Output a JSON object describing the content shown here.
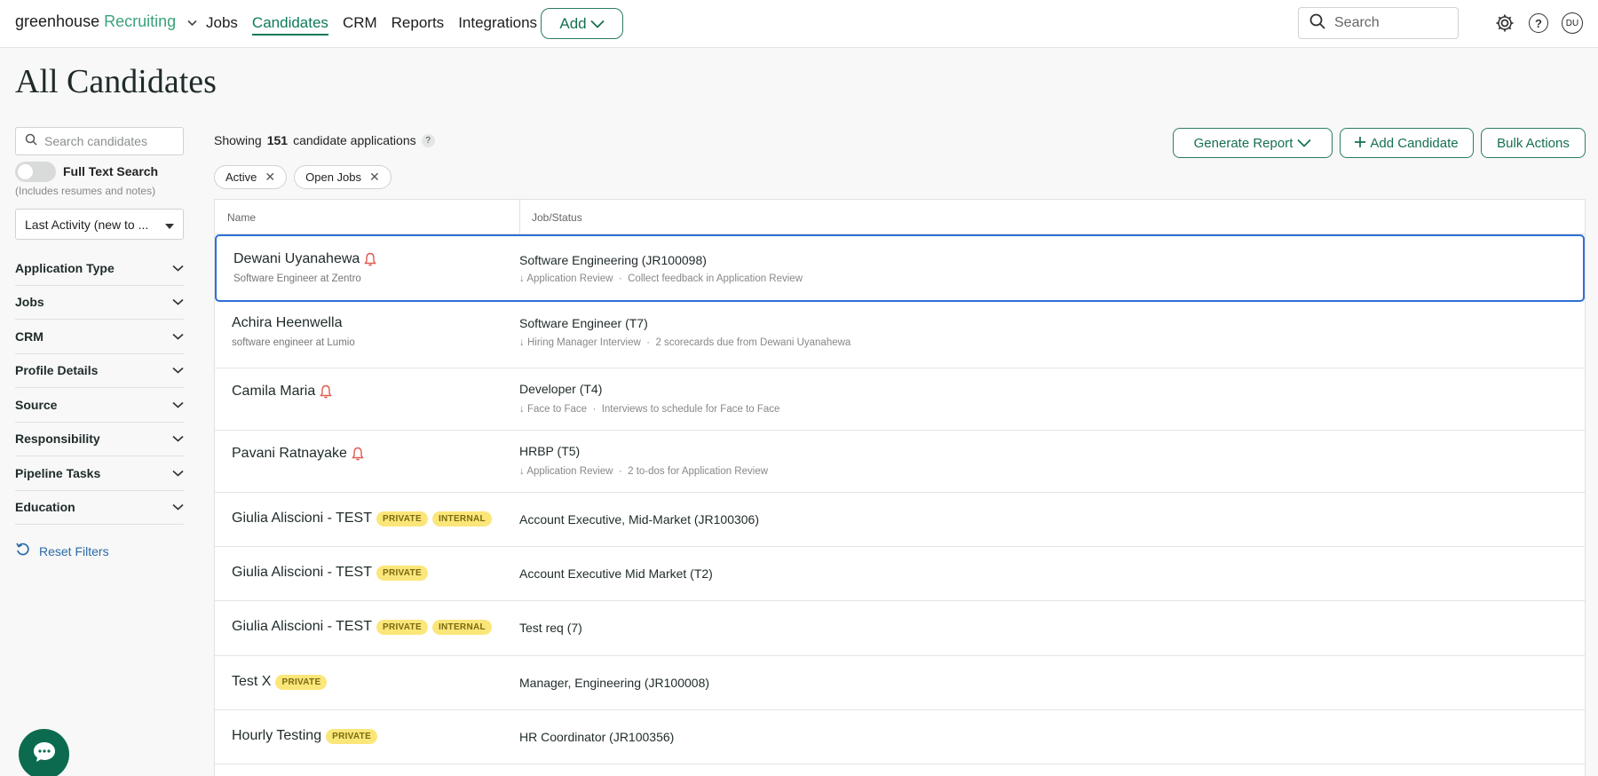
{
  "topnav": {
    "brand_primary": "greenhouse",
    "brand_secondary": "Recruiting",
    "links": [
      "Jobs",
      "Candidates",
      "CRM",
      "Reports",
      "Integrations"
    ],
    "active_link": "Candidates",
    "add_label": "Add",
    "search_placeholder": "Search",
    "avatar_initials": "DU"
  },
  "page": {
    "title": "All Candidates"
  },
  "sidebar": {
    "search_placeholder": "Search candidates",
    "full_text_label": "Full Text Search",
    "full_text_note": "(Includes resumes and notes)",
    "full_text_enabled": false,
    "sort_value": "Last Activity (new to ...",
    "filters": [
      "Application Type",
      "Jobs",
      "CRM",
      "Profile Details",
      "Source",
      "Responsibility",
      "Pipeline Tasks",
      "Education"
    ],
    "reset_label": "Reset Filters"
  },
  "main": {
    "showing_prefix": "Showing",
    "showing_count": "151",
    "showing_suffix": "candidate applications",
    "help_glyph": "?",
    "chips": [
      "Active",
      "Open Jobs"
    ],
    "generate_report_label": "Generate Report",
    "add_candidate_label": "Add Candidate",
    "bulk_actions_label": "Bulk Actions",
    "columns": {
      "name": "Name",
      "job_status": "Job/Status"
    }
  },
  "rows": [
    {
      "name": "Dewani Uyanahewa",
      "alert": true,
      "subtitle": "Software Engineer at Zentro",
      "badges": [],
      "job": "Software Engineering (JR100098)",
      "stage": "Application Review",
      "status": "Collect feedback in Application Review",
      "selected": true
    },
    {
      "name": "Achira Heenwella",
      "alert": false,
      "subtitle": "software engineer at Lumio",
      "badges": [],
      "job": "Software Engineer (T7)",
      "stage": "Hiring Manager Interview",
      "status": "2 scorecards due from Dewani Uyanahewa",
      "selected": false
    },
    {
      "name": "Camila Maria",
      "alert": true,
      "subtitle": "",
      "badges": [],
      "job": "Developer (T4)",
      "stage": "Face to Face",
      "status": "Interviews to schedule for Face to Face",
      "selected": false
    },
    {
      "name": "Pavani Ratnayake",
      "alert": true,
      "subtitle": "",
      "badges": [],
      "job": "HRBP (T5)",
      "stage": "Application Review",
      "status": "2 to-dos for Application Review",
      "selected": false
    },
    {
      "name": "Giulia Aliscioni - TEST",
      "alert": false,
      "subtitle": "",
      "badges": [
        "PRIVATE",
        "INTERNAL"
      ],
      "job": "Account Executive, Mid-Market (JR100306)",
      "stage": "",
      "status": "",
      "selected": false
    },
    {
      "name": "Giulia Aliscioni - TEST",
      "alert": false,
      "subtitle": "",
      "badges": [
        "PRIVATE"
      ],
      "job": "Account Executive Mid Market (T2)",
      "stage": "",
      "status": "",
      "selected": false
    },
    {
      "name": "Giulia Aliscioni - TEST",
      "alert": false,
      "subtitle": "",
      "badges": [
        "PRIVATE",
        "INTERNAL"
      ],
      "job": "Test req (7)",
      "stage": "",
      "status": "",
      "selected": false
    },
    {
      "name": "Test X",
      "alert": false,
      "subtitle": "",
      "badges": [
        "PRIVATE"
      ],
      "job": "Manager, Engineering (JR100008)",
      "stage": "",
      "status": "",
      "selected": false
    },
    {
      "name": "Hourly Testing",
      "alert": false,
      "subtitle": "",
      "badges": [
        "PRIVATE"
      ],
      "job": "HR Coordinator (JR100356)",
      "stage": "",
      "status": "",
      "selected": false
    }
  ],
  "colors": {
    "brand_green": "#0d7a5b",
    "badge_yellow": "#fbe67a",
    "alert_red": "#e05a4f",
    "selection_blue": "#2f6fd6"
  }
}
